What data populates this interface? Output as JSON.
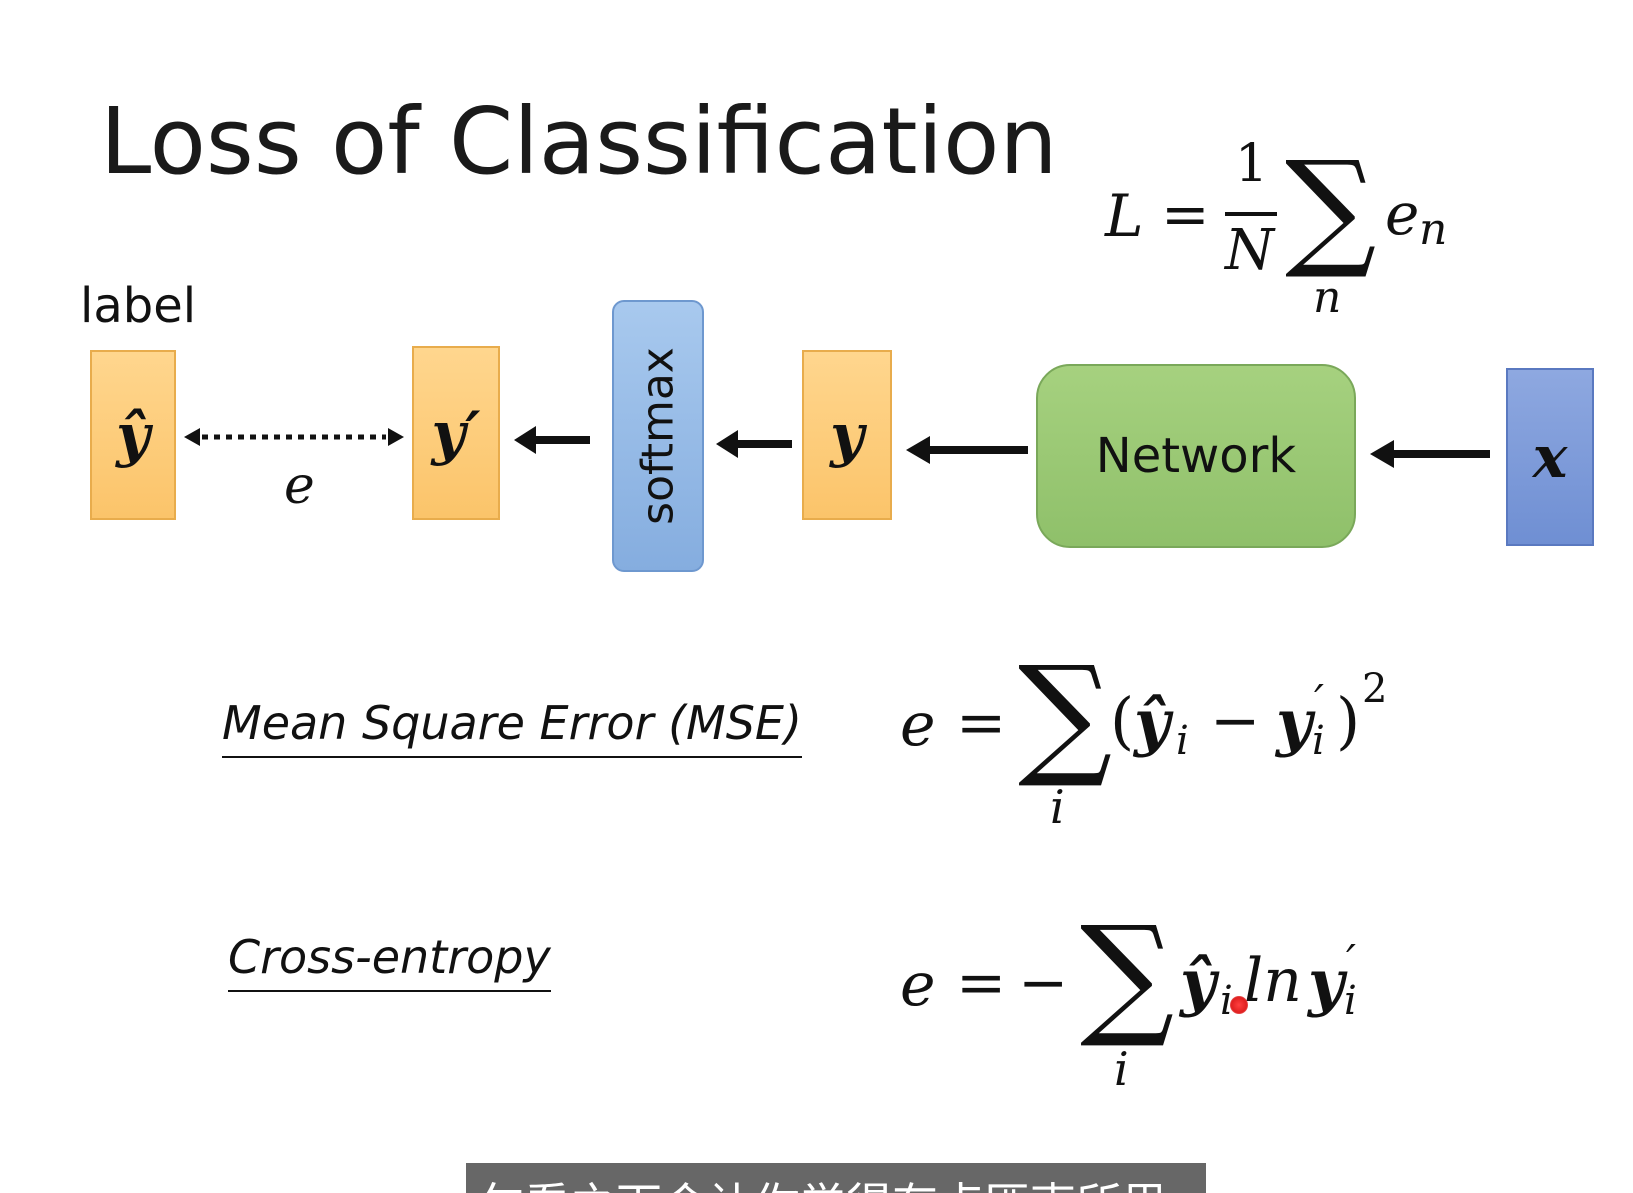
{
  "slide": {
    "title": "Loss of Classification"
  },
  "loss_formula": {
    "lhs": "L",
    "equals": "=",
    "numerator": "1",
    "denominator": "N",
    "sigma": "∑",
    "sub": "n",
    "term": "e",
    "term_sub": "n"
  },
  "diagram": {
    "label_caption": "label",
    "label_box": "ŷ",
    "error_symbol": "e",
    "output_box": "y′",
    "softmax": "softmax",
    "y_box": "y",
    "network": "Network",
    "input_box": "x",
    "colors": {
      "orange": "#fbc46a",
      "blue": "#85addf",
      "green": "#8fc06a",
      "input_blue": "#6f8fd3"
    }
  },
  "mse": {
    "name": "Mean Square Error (MSE)",
    "lhs": "e",
    "equals": "=",
    "sigma": "∑",
    "sub": "i",
    "open": "(",
    "yhat": "ŷ",
    "yhat_sub": "i",
    "minus": "−",
    "y": "y",
    "y_prime": "′",
    "y_sub": "i",
    "close": ")",
    "exp": "2"
  },
  "cross_entropy": {
    "name": "Cross-entropy",
    "lhs": "e",
    "equals": "=",
    "neg": "−",
    "sigma": "∑",
    "sub": "i",
    "yhat": "ŷ",
    "yhat_sub": "i",
    "ln": "ln",
    "y": "y",
    "y_prime": "′",
    "y_sub": "i"
  },
  "subtitle": {
    "text": "乍看之下会让你觉得有点匪夷所思"
  }
}
